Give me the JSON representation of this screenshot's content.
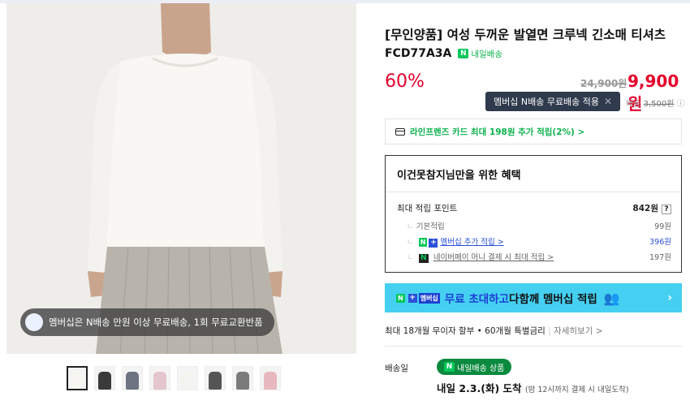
{
  "gallery": {
    "notice": "멤버십은 N배송 만원 이상 무료배송, 1회 무료교환반품",
    "thumb_colors": [
      "#f6f5f2",
      "#3a3a3a",
      "#6d7482",
      "#e4c6cc",
      "#f3f3f0",
      "#555555",
      "#7b7b7b",
      "#e7b8be"
    ]
  },
  "product": {
    "title": "[무인양품] 여성 두꺼운 발열면 크루넥 긴소매 티셔츠",
    "code": "FCD77A3A",
    "delivery_badge": "내일배송",
    "discount_rate": "60%",
    "original_price": "24,900원",
    "sale_price": "9,900원",
    "tooltip": "멤버십 N배송 무료배송 적용",
    "shipping_prefix": "배송",
    "shipping_fee": "3,500원",
    "card_benefit": "라인프렌즈 카드 최대 198원 추가 적립(2%) >"
  },
  "benefit": {
    "header": "이건못참지님만을 위한 혜택",
    "max_points_label": "최대 적립 포인트",
    "max_points_value": "842원",
    "rows": [
      {
        "label": "기본적립",
        "value": "99원"
      },
      {
        "label": "멤버십 추가 적립 >",
        "value": "396원"
      },
      {
        "label": "네이버페이 머니 결제 시 최대 적립 >",
        "value": "197원"
      }
    ]
  },
  "banner": {
    "n_label": "N",
    "plus_label": "+",
    "membership_label": "멤버십",
    "highlight": "무료 초대하고",
    "text": "다함께 멤버십 적립",
    "arrow": "›"
  },
  "installment": {
    "text": "최대 18개월 무이자 할부 • 60개월 특별금리",
    "more": "자세히보기 >"
  },
  "delivery": {
    "label": "배송일",
    "tag": "내일배송 상품",
    "date": "내일 2.3.(화) 도착",
    "note": "(밤 12시까지 결제 시 내일도착)"
  },
  "colors": {
    "accent_red": "#e4002b",
    "naver_green": "#03c75a",
    "banner_cyan": "#45d0f2",
    "link_blue": "#2a50d9"
  }
}
